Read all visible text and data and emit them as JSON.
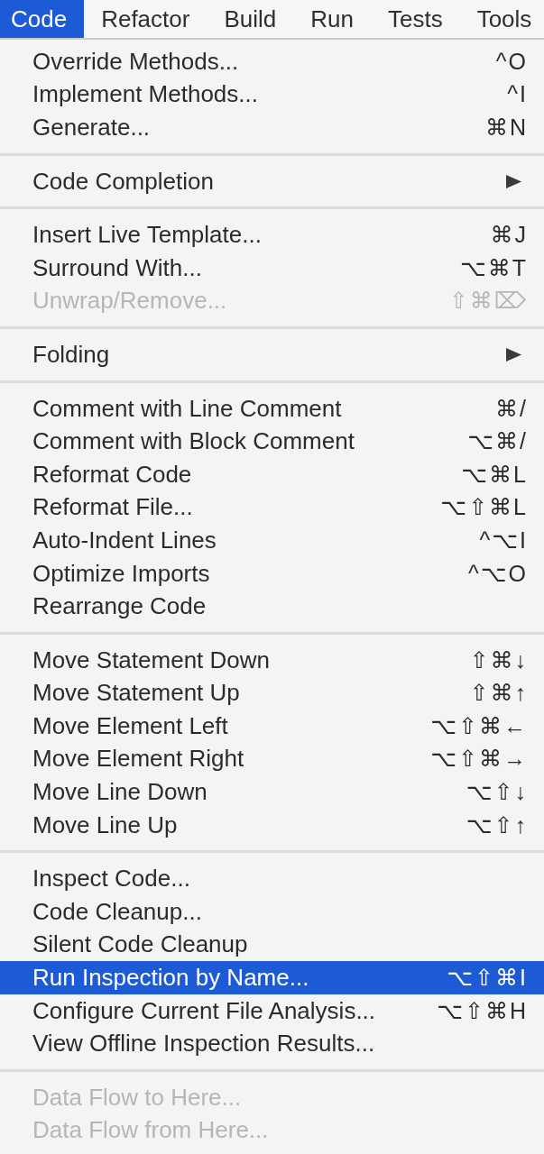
{
  "menu_bar": [
    {
      "label": "Code",
      "selected": true
    },
    {
      "label": "Refactor",
      "selected": false
    },
    {
      "label": "Build",
      "selected": false
    },
    {
      "label": "Run",
      "selected": false
    },
    {
      "label": "Tests",
      "selected": false
    },
    {
      "label": "Tools",
      "selected": false
    }
  ],
  "menu": {
    "groups": [
      {
        "items": [
          {
            "kind": "action",
            "label": "Override Methods...",
            "shortcut": "^O",
            "selected": false,
            "disabled": false
          },
          {
            "kind": "action",
            "label": "Implement Methods...",
            "shortcut": "^I",
            "selected": false,
            "disabled": false
          },
          {
            "kind": "action",
            "label": "Generate...",
            "shortcut": "⌘N",
            "selected": false,
            "disabled": false
          }
        ]
      },
      {
        "items": [
          {
            "kind": "submenu",
            "label": "Code Completion",
            "selected": false,
            "disabled": false
          }
        ]
      },
      {
        "items": [
          {
            "kind": "action",
            "label": "Insert Live Template...",
            "shortcut": "⌘J",
            "selected": false,
            "disabled": false
          },
          {
            "kind": "action",
            "label": "Surround With...",
            "shortcut": "⌥⌘T",
            "selected": false,
            "disabled": false
          },
          {
            "kind": "action",
            "label": "Unwrap/Remove...",
            "shortcut": "⇧⌘⌦",
            "selected": false,
            "disabled": true
          }
        ]
      },
      {
        "items": [
          {
            "kind": "submenu",
            "label": "Folding",
            "selected": false,
            "disabled": false
          }
        ]
      },
      {
        "items": [
          {
            "kind": "action",
            "label": "Comment with Line Comment",
            "shortcut": "⌘/",
            "selected": false,
            "disabled": false
          },
          {
            "kind": "action",
            "label": "Comment with Block Comment",
            "shortcut": "⌥⌘/",
            "selected": false,
            "disabled": false
          },
          {
            "kind": "action",
            "label": "Reformat Code",
            "shortcut": "⌥⌘L",
            "selected": false,
            "disabled": false
          },
          {
            "kind": "action",
            "label": "Reformat File...",
            "shortcut": "⌥⇧⌘L",
            "selected": false,
            "disabled": false
          },
          {
            "kind": "action",
            "label": "Auto-Indent Lines",
            "shortcut": "^⌥I",
            "selected": false,
            "disabled": false
          },
          {
            "kind": "action",
            "label": "Optimize Imports",
            "shortcut": "^⌥O",
            "selected": false,
            "disabled": false
          },
          {
            "kind": "action",
            "label": "Rearrange Code",
            "selected": false,
            "disabled": false
          }
        ]
      },
      {
        "items": [
          {
            "kind": "action",
            "label": "Move Statement Down",
            "shortcut": "⇧⌘↓",
            "selected": false,
            "disabled": false
          },
          {
            "kind": "action",
            "label": "Move Statement Up",
            "shortcut": "⇧⌘↑",
            "selected": false,
            "disabled": false
          },
          {
            "kind": "action",
            "label": "Move Element Left",
            "shortcut": "⌥⇧⌘←",
            "selected": false,
            "disabled": false
          },
          {
            "kind": "action",
            "label": "Move Element Right",
            "shortcut": "⌥⇧⌘→",
            "selected": false,
            "disabled": false
          },
          {
            "kind": "action",
            "label": "Move Line Down",
            "shortcut": "⌥⇧↓",
            "selected": false,
            "disabled": false
          },
          {
            "kind": "action",
            "label": "Move Line Up",
            "shortcut": "⌥⇧↑",
            "selected": false,
            "disabled": false
          }
        ]
      },
      {
        "items": [
          {
            "kind": "action",
            "label": "Inspect Code...",
            "selected": false,
            "disabled": false
          },
          {
            "kind": "action",
            "label": "Code Cleanup...",
            "selected": false,
            "disabled": false
          },
          {
            "kind": "action",
            "label": "Silent Code Cleanup",
            "selected": false,
            "disabled": false
          },
          {
            "kind": "action",
            "label": "Run Inspection by Name...",
            "shortcut": "⌥⇧⌘I",
            "selected": true,
            "disabled": false
          },
          {
            "kind": "action",
            "label": "Configure Current File Analysis...",
            "shortcut": "⌥⇧⌘H",
            "selected": false,
            "disabled": false
          },
          {
            "kind": "action",
            "label": "View Offline Inspection Results...",
            "selected": false,
            "disabled": false
          }
        ]
      },
      {
        "items": [
          {
            "kind": "action",
            "label": "Data Flow to Here...",
            "selected": false,
            "disabled": true
          },
          {
            "kind": "action",
            "label": "Data Flow from Here...",
            "selected": false,
            "disabled": true
          }
        ]
      }
    ]
  }
}
